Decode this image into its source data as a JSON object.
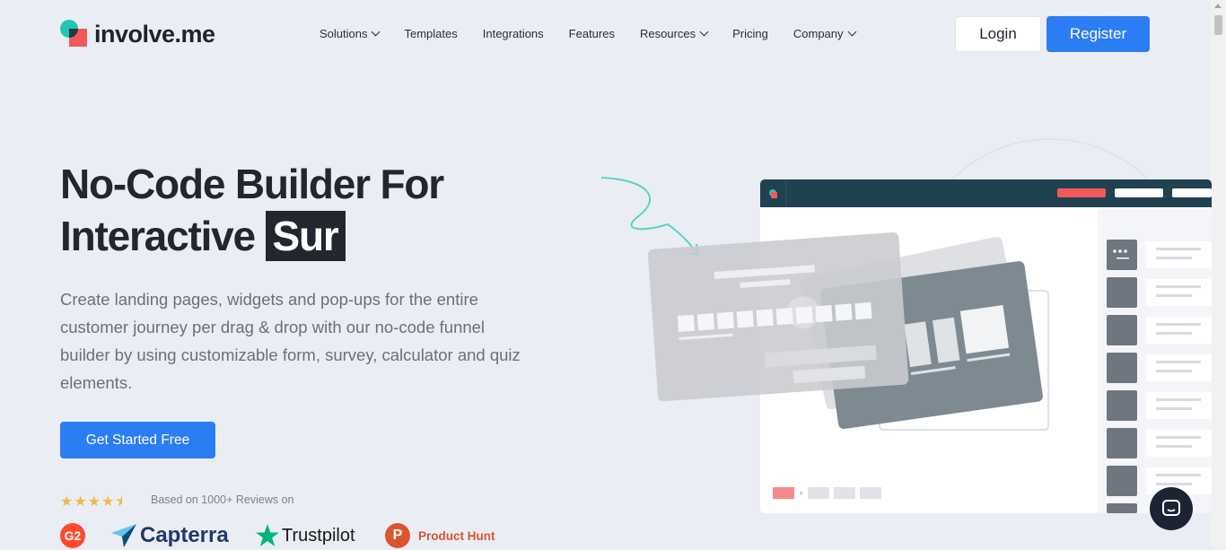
{
  "brand": {
    "name": "involve.me"
  },
  "nav": {
    "items": [
      {
        "label": "Solutions",
        "dropdown": true
      },
      {
        "label": "Templates",
        "dropdown": false
      },
      {
        "label": "Integrations",
        "dropdown": false
      },
      {
        "label": "Features",
        "dropdown": false
      },
      {
        "label": "Resources",
        "dropdown": true
      },
      {
        "label": "Pricing",
        "dropdown": false
      },
      {
        "label": "Company",
        "dropdown": true
      }
    ],
    "login_label": "Login",
    "register_label": "Register"
  },
  "hero": {
    "title_line1": "No-Code Builder For",
    "title_line2_prefix": "Interactive",
    "title_highlight": "Sur",
    "description": "Create landing pages, widgets and pop-ups for the entire customer journey per drag & drop with our no-code funnel builder by using customizable form, survey, calculator and quiz elements.",
    "cta_label": "Get Started Free"
  },
  "reviews": {
    "rating": 4.5,
    "stars_text": "★★★★",
    "label": "Based on 1000+ Reviews on",
    "platforms": [
      {
        "name": "G2",
        "mark": "G2"
      },
      {
        "name": "Capterra"
      },
      {
        "name": "Trustpilot"
      },
      {
        "name": "Product Hunt",
        "mark": "P"
      }
    ]
  },
  "colors": {
    "accent": "#2b7df3",
    "background": "#ebedf5",
    "header_dark": "#1f4150",
    "brand_red": "#f25a5a",
    "brand_teal": "#22c6b0"
  }
}
